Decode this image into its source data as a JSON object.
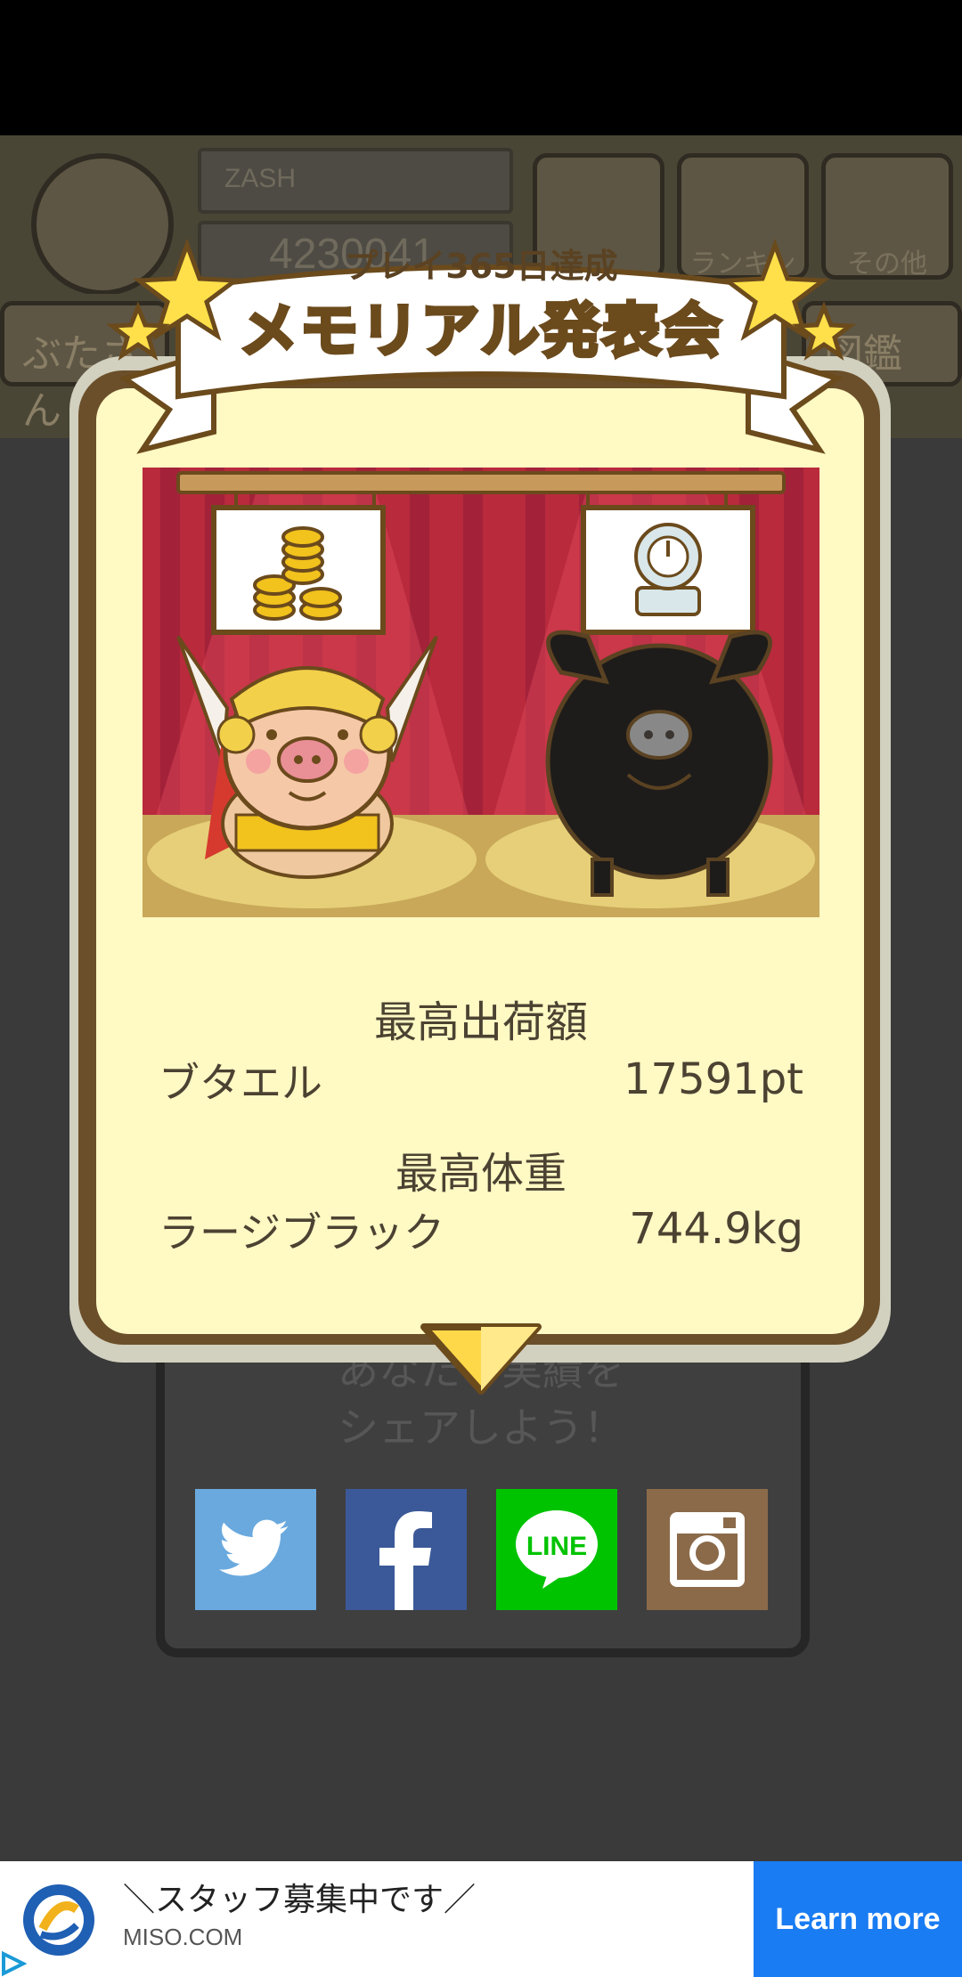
{
  "background": {
    "player_name": "ZASH",
    "coins": "4230041",
    "top_buttons": [
      "",
      "ランキング",
      "その他"
    ],
    "tabs_left": "ぶたさん",
    "tabs_right": "図鑑",
    "share_prompt_line1": "あなたの実績を",
    "share_prompt_line2": "シェアしよう！"
  },
  "dialog": {
    "banner_subtitle": "プレイ365日達成",
    "banner_title": "メモリアル発表会",
    "stats": [
      {
        "title": "最高出荷額",
        "name": "ブタエル",
        "value": "17591pt"
      },
      {
        "title": "最高体重",
        "name": "ラージブラック",
        "value": "744.9kg"
      }
    ]
  },
  "share": {
    "icons": [
      "twitter-icon",
      "facebook-icon",
      "line-icon",
      "instagram-icon"
    ],
    "line_label": "LINE"
  },
  "ad": {
    "title": "＼スタッフ募集中です／",
    "domain": "MISO.COM",
    "cta": "Learn more"
  },
  "colors": {
    "twitter": "#6aa9de",
    "facebook": "#3b5998",
    "line": "#00c300",
    "instagram": "#8b6a4a",
    "cta": "#1a7cf2"
  }
}
